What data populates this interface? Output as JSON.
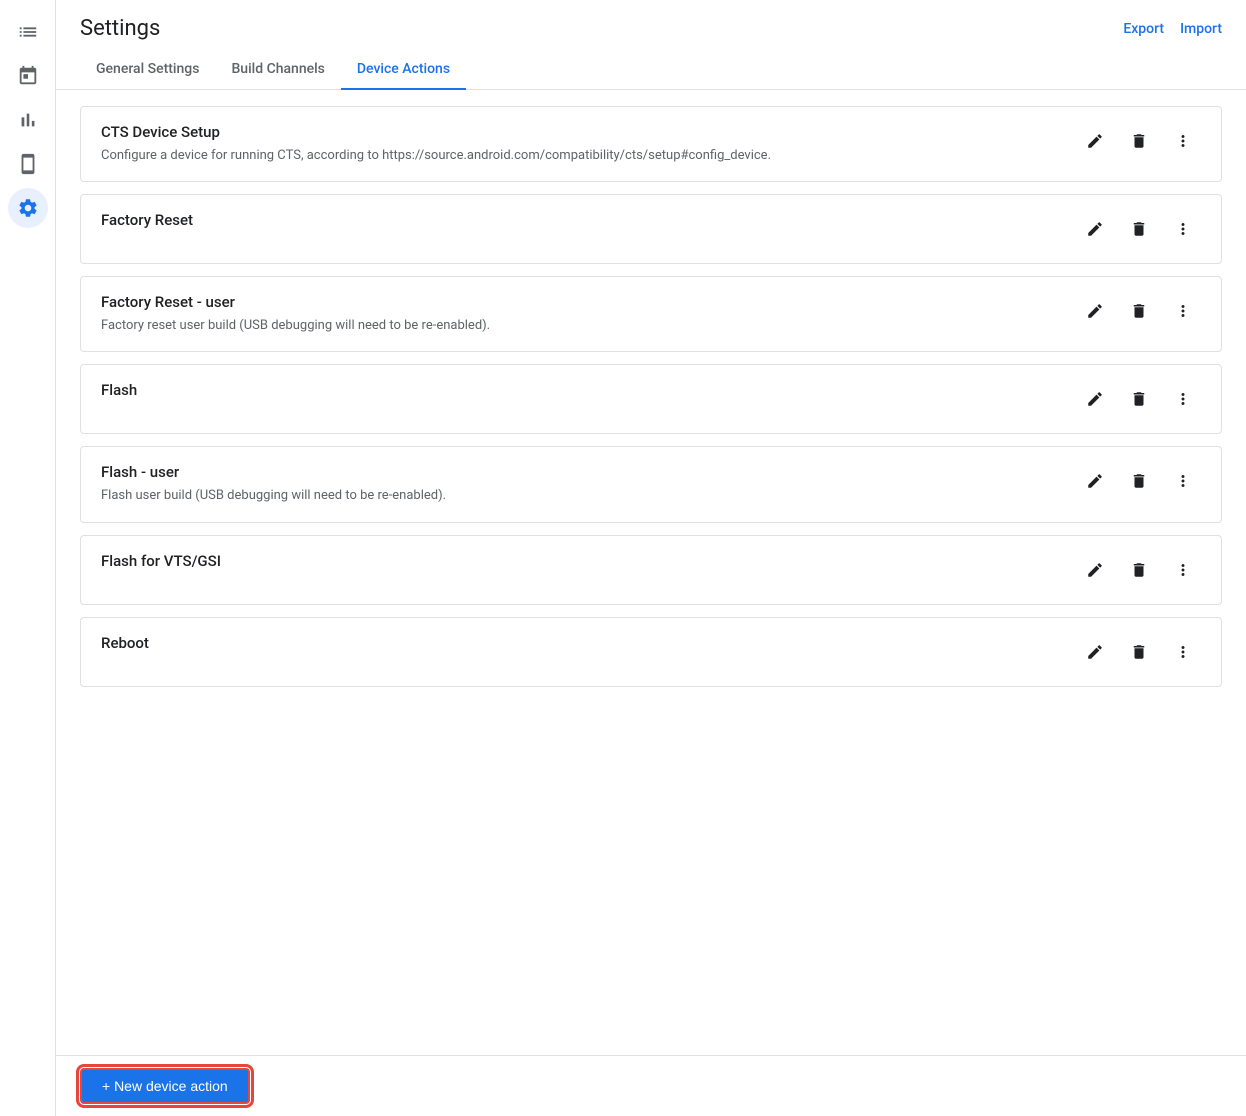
{
  "page": {
    "title": "Settings",
    "export_label": "Export",
    "import_label": "Import"
  },
  "tabs": [
    {
      "id": "general",
      "label": "General Settings",
      "active": false
    },
    {
      "id": "build-channels",
      "label": "Build Channels",
      "active": false
    },
    {
      "id": "device-actions",
      "label": "Device Actions",
      "active": true
    }
  ],
  "sidebar": {
    "items": [
      {
        "id": "list",
        "icon": "list-icon",
        "label": "List"
      },
      {
        "id": "calendar",
        "icon": "calendar-icon",
        "label": "Calendar"
      },
      {
        "id": "analytics",
        "icon": "analytics-icon",
        "label": "Analytics"
      },
      {
        "id": "device",
        "icon": "device-icon",
        "label": "Device"
      },
      {
        "id": "settings",
        "icon": "settings-icon",
        "label": "Settings",
        "active": true
      }
    ]
  },
  "device_actions": [
    {
      "id": "cts-device-setup",
      "title": "CTS Device Setup",
      "description": "Configure a device for running CTS, according to https://source.android.com/compatibility/cts/setup#config_device."
    },
    {
      "id": "factory-reset",
      "title": "Factory Reset",
      "description": ""
    },
    {
      "id": "factory-reset-user",
      "title": "Factory Reset - user",
      "description": "Factory reset user build (USB debugging will need to be re-enabled)."
    },
    {
      "id": "flash",
      "title": "Flash",
      "description": ""
    },
    {
      "id": "flash-user",
      "title": "Flash - user",
      "description": "Flash user build (USB debugging will need to be re-enabled)."
    },
    {
      "id": "flash-vts-gsi",
      "title": "Flash for VTS/GSI",
      "description": ""
    },
    {
      "id": "reboot",
      "title": "Reboot",
      "description": ""
    }
  ],
  "bottom": {
    "new_action_label": "+ New device action"
  }
}
